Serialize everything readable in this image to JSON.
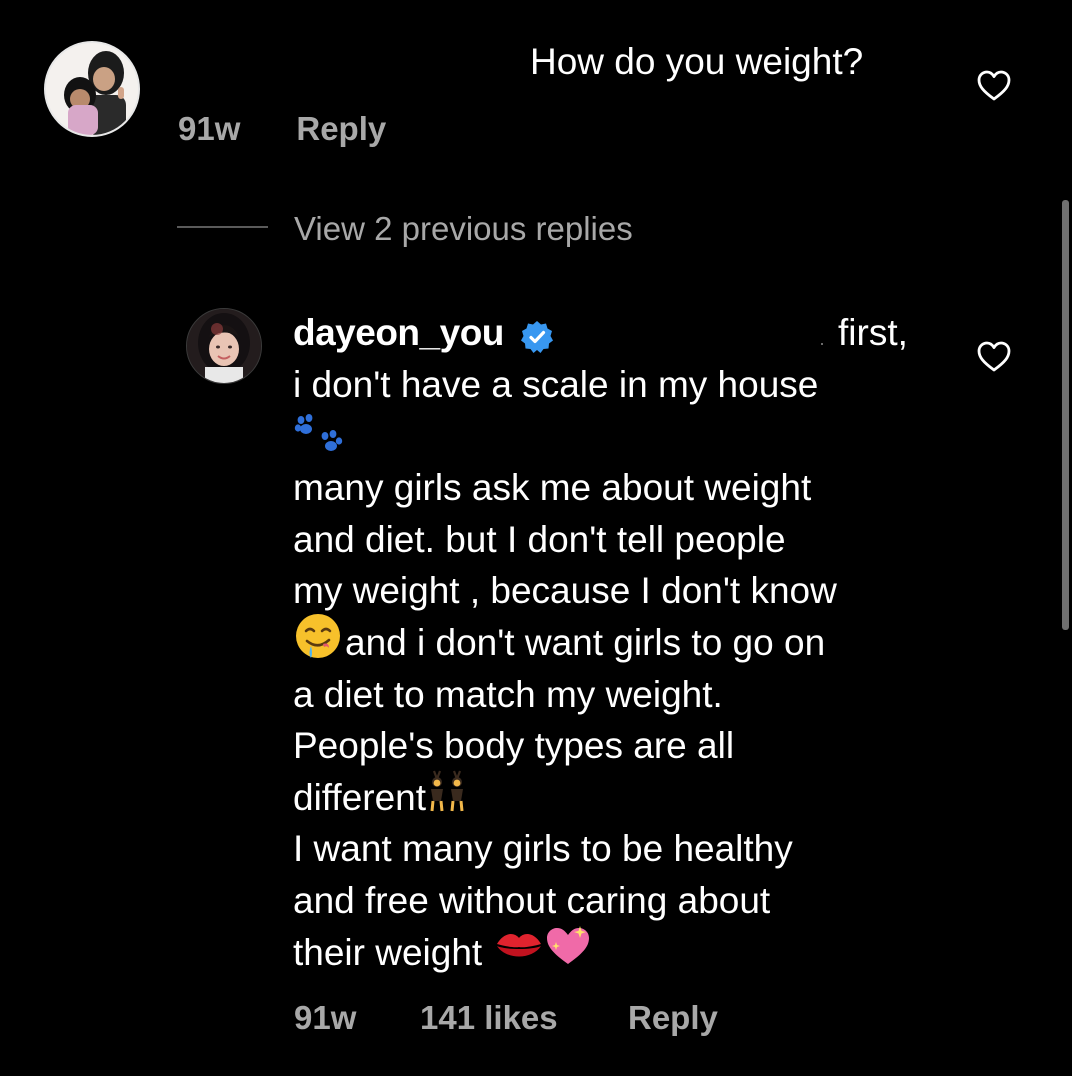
{
  "comment": {
    "text": "How do you weight?",
    "time": "91w",
    "reply_label": "Reply",
    "like_icon": "heart-outline-icon"
  },
  "view_replies": "View 2 previous replies",
  "reply": {
    "username": "dayeon_you",
    "verified_icon": "verified-badge-icon",
    "first_word": "first,",
    "lines": {
      "l1": "i don't have a scale in my house",
      "l3": "many girls ask me about weight",
      "l4": "and diet. but I don't tell people",
      "l5": "my weight , because I don't know",
      "l6": "and i don't want girls to go on",
      "l7": "a diet to match my weight.",
      "l8": "People's body types are all",
      "l9": "different",
      "l10": "I want many girls to be healthy",
      "l11": "and free without caring about",
      "l12": "their weight"
    },
    "emojis": {
      "paw": "paw-prints-emoji",
      "drool": "drooling-face-emoji",
      "dancers": "women-with-bunny-ears-emoji",
      "lips": "kiss-mark-emoji",
      "heart": "sparkling-heart-emoji"
    },
    "time": "91w",
    "likes": "141 likes",
    "reply_label": "Reply",
    "like_icon": "heart-outline-icon"
  },
  "colors": {
    "background": "#000000",
    "text": "#ffffff",
    "meta": "#a8a8a8",
    "verified": "#3897f0"
  }
}
